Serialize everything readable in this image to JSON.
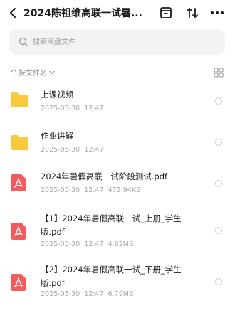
{
  "header": {
    "title": "2024陈祖维高联一试暑..."
  },
  "search": {
    "placeholder": "搜索网盘文件"
  },
  "sort": {
    "label": "按文件名"
  },
  "files": [
    {
      "name": "上课视频",
      "date": "2025-05-30",
      "time": "12:47",
      "size": "",
      "type": "folder"
    },
    {
      "name": "作业讲解",
      "date": "2025-05-30",
      "time": "12:47",
      "size": "",
      "type": "folder"
    },
    {
      "name": "2024年暑假高联一试阶段测试.pdf",
      "date": "2025-05-30",
      "time": "12:47",
      "size": "473.94KB",
      "type": "pdf"
    },
    {
      "name": "【1】2024年暑假高联一试_上册_学生版.pdf",
      "date": "2025-05-30",
      "time": "12:47",
      "size": "4.82MB",
      "type": "pdf"
    },
    {
      "name": "【2】2024年暑假高联一试_下册_学生版.pdf",
      "date": "2025-05-30",
      "time": "12:47",
      "size": "6.79MB",
      "type": "pdf"
    }
  ],
  "colors": {
    "folder": "#f8c93d",
    "pdf": "#f25c5c",
    "accent": "#1f1f1f"
  }
}
